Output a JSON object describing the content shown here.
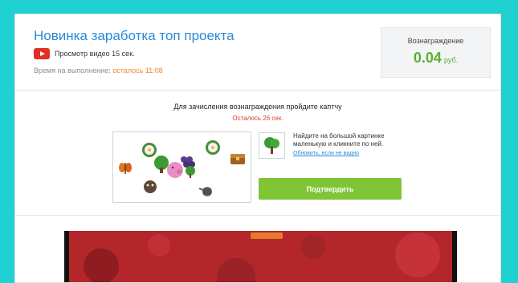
{
  "task": {
    "title": "Новинка заработка топ проекта",
    "type_label": "Просмотр видео 15 сек.",
    "time_label": "Время на выполнение:",
    "time_left": "осталось 11:08"
  },
  "reward": {
    "label": "Вознаграждение",
    "amount": "0.04",
    "unit": "руб."
  },
  "captcha": {
    "title": "Для зачисления вознаграждения пройдите каптчу",
    "remaining": "Осталось 26 сек.",
    "instruction": "Найдите на большой картинке маленькую и кликните по ней.",
    "refresh_link": "Обновить, если не видно",
    "confirm_label": "Подтвердить"
  },
  "colors": {
    "background": "#1fd1d0",
    "title_blue": "#2a8ad6",
    "reward_green": "#5ab130",
    "button_green": "#80c536",
    "timer_orange": "#f08a2c",
    "alert_red": "#e03b2e"
  }
}
